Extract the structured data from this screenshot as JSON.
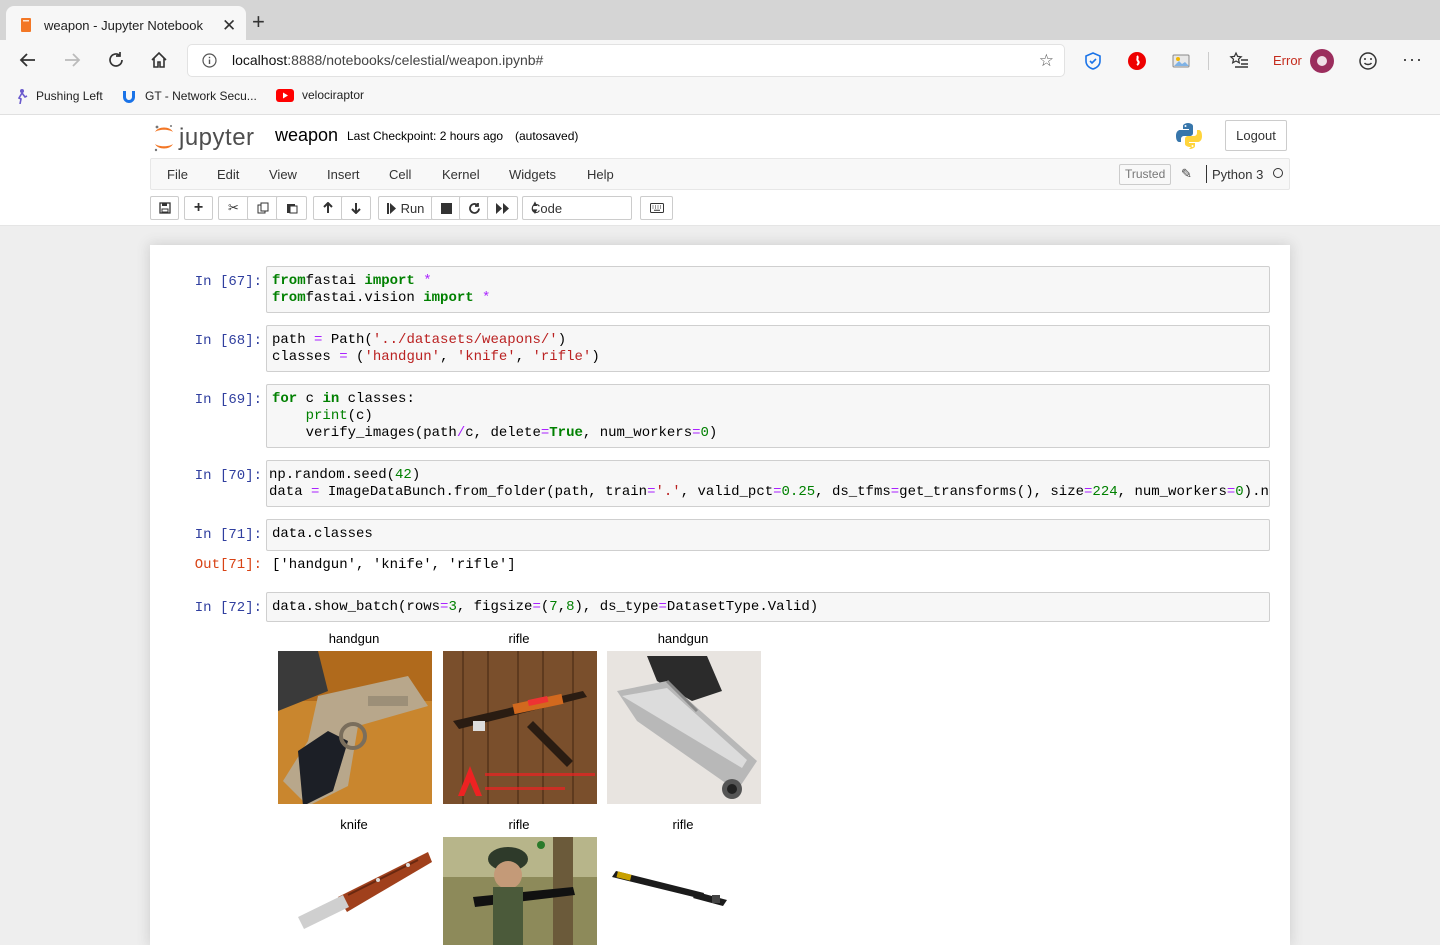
{
  "browser": {
    "tab_title": "weapon - Jupyter Notebook",
    "url_host": "localhost",
    "url_rest": ":8888/notebooks/celestial/weapon.ipynb#",
    "profile_status": "Error",
    "bookmarks": [
      "Pushing Left",
      "GT - Network Secu...",
      "velociraptor"
    ]
  },
  "jupyter": {
    "logo_text": "jupyter",
    "notebook_name": "weapon",
    "checkpoint": "Last Checkpoint: 2 hours ago",
    "autosave": "(autosaved)",
    "logout_label": "Logout",
    "menu": [
      "File",
      "Edit",
      "View",
      "Insert",
      "Cell",
      "Kernel",
      "Widgets",
      "Help"
    ],
    "trusted": "Trusted",
    "kernel": "Python 3",
    "toolbar": {
      "run_label": "Run",
      "cell_type": "Code"
    }
  },
  "cells": [
    {
      "prompt": "In [67]:"
    },
    {
      "prompt": "In [68]:"
    },
    {
      "prompt": "In [69]:"
    },
    {
      "prompt": "In [70]:"
    },
    {
      "prompt": "In [71]:",
      "out_prompt": "Out[71]:",
      "output": "['handgun', 'knife', 'rifle']"
    },
    {
      "prompt": "In [72]:"
    }
  ],
  "code": {
    "c67": [
      [
        [
          "kw",
          "from"
        ],
        [
          "",
          "fastai "
        ],
        [
          "kw",
          "import"
        ],
        [
          "op",
          " *"
        ]
      ],
      [
        [
          "kw",
          "from"
        ],
        [
          "",
          "fastai.vision "
        ],
        [
          "kw",
          "import"
        ],
        [
          "op",
          " *"
        ]
      ]
    ],
    "c68": [
      [
        [
          "",
          "path "
        ],
        [
          "op",
          "="
        ],
        [
          "",
          " Path("
        ],
        [
          "st",
          "'../datasets/weapons/'"
        ],
        [
          "",
          ")"
        ]
      ],
      [
        [
          "",
          "classes "
        ],
        [
          "op",
          "="
        ],
        [
          "",
          " ("
        ],
        [
          "st",
          "'handgun'"
        ],
        [
          "",
          ", "
        ],
        [
          "st",
          "'knife'"
        ],
        [
          "",
          ", "
        ],
        [
          "st",
          "'rifle'"
        ],
        [
          "",
          ")"
        ]
      ]
    ],
    "c69": [
      [
        [
          "kw",
          "for"
        ],
        [
          "",
          " c "
        ],
        [
          "kw",
          "in"
        ],
        [
          "",
          " classes:"
        ]
      ],
      [
        [
          "",
          "    "
        ],
        [
          "bi",
          "print"
        ],
        [
          "",
          "(c)"
        ]
      ],
      [
        [
          "",
          "    verify_images(path"
        ],
        [
          "op",
          "/"
        ],
        [
          "",
          "c, delete"
        ],
        [
          "op",
          "="
        ],
        [
          "kw",
          "True"
        ],
        [
          "",
          ", num_workers"
        ],
        [
          "op",
          "="
        ],
        [
          "nm",
          "0"
        ],
        [
          "",
          ")"
        ]
      ]
    ],
    "c70": [
      [
        [
          "",
          "np.random.seed("
        ],
        [
          "nm",
          "42"
        ],
        [
          "",
          ")"
        ]
      ],
      [
        [
          "",
          "data "
        ],
        [
          "op",
          "="
        ],
        [
          "",
          " ImageDataBunch.from_folder(path, train"
        ],
        [
          "op",
          "="
        ],
        [
          "st",
          "'.'"
        ],
        [
          "",
          ", valid_pct"
        ],
        [
          "op",
          "="
        ],
        [
          "nm",
          "0.25"
        ],
        [
          "",
          ", ds_tfms"
        ],
        [
          "op",
          "="
        ],
        [
          "",
          "get_transforms(), size"
        ],
        [
          "op",
          "="
        ],
        [
          "nm",
          "224"
        ],
        [
          "",
          ", num_workers"
        ],
        [
          "op",
          "="
        ],
        [
          "nm",
          "0"
        ],
        [
          "",
          ").n"
        ]
      ]
    ],
    "c71": [
      [
        [
          "",
          "data.classes"
        ]
      ]
    ],
    "c72": [
      [
        [
          "",
          "data.show_batch(rows"
        ],
        [
          "op",
          "="
        ],
        [
          "nm",
          "3"
        ],
        [
          "",
          ", figsize"
        ],
        [
          "op",
          "="
        ],
        [
          "",
          "("
        ],
        [
          "nm",
          "7"
        ],
        [
          "",
          ","
        ],
        [
          "nm",
          "8"
        ],
        [
          "",
          "), ds_type"
        ],
        [
          "op",
          "="
        ],
        [
          "",
          "DatasetType.Valid)"
        ]
      ]
    ]
  },
  "batch_images": [
    {
      "label": "handgun",
      "subject": "handgun-photo"
    },
    {
      "label": "rifle",
      "subject": "rifle-on-wood-photo"
    },
    {
      "label": "handgun",
      "subject": "silver-pistol-photo"
    },
    {
      "label": "knife",
      "subject": "knife-photo"
    },
    {
      "label": "rifle",
      "subject": "soldier-rifle-photo"
    },
    {
      "label": "rifle",
      "subject": "rifle-photo"
    }
  ],
  "colors": {
    "prompt_in": "#303f9f",
    "prompt_out": "#d84315",
    "keyword": "#008000",
    "string": "#ba2121",
    "operator": "#aa22ff",
    "error": "#c42b1c"
  }
}
